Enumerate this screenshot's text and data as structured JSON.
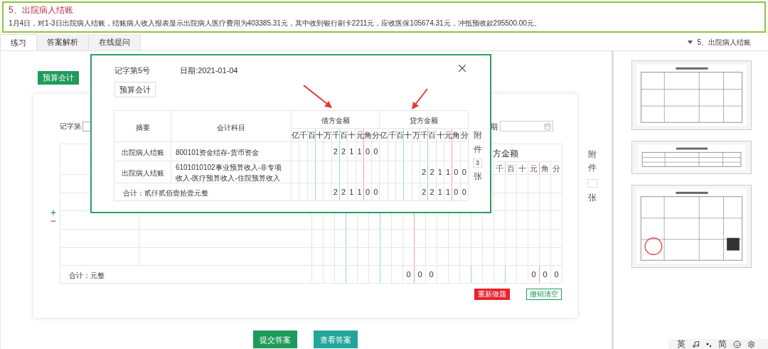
{
  "question": {
    "title": "5、出院病人结账",
    "description": "1月4日，对1-3日出院病人结账，结账病人收入报表显示出院病人医疗费用为403385.31元，其中收到银行刷卡2211元，应收医保105674.31元，冲抵预收款295500.00元。"
  },
  "tabs": [
    {
      "label": "练习",
      "selected": true
    },
    {
      "label": "答案解析",
      "selected": false
    },
    {
      "label": "在线提问",
      "selected": false
    }
  ],
  "question_selector": "5、出院病人结账",
  "ledger_button": "预算会计",
  "voucher_form": {
    "number_label": "记字第",
    "date_label": "期",
    "credit_header": "方金额",
    "credit_digit_labels": [
      "千",
      "百",
      "十",
      "元",
      "角",
      "分"
    ],
    "total_label": "合计：元整",
    "total_debit": [
      "0",
      "0",
      "0"
    ],
    "total_credit": [
      "0",
      "0",
      "0"
    ],
    "attachments_label": "附件",
    "attachments_unit": "张"
  },
  "form_buttons": [
    {
      "label": "重新做题",
      "kind": "danger"
    },
    {
      "label": "撤销清空",
      "kind": "outline"
    }
  ],
  "bottom_buttons": [
    {
      "label": "提交答案",
      "kind": "primary"
    },
    {
      "label": "查看答案",
      "kind": "secondary"
    }
  ],
  "dialog": {
    "voucher_no": "记字第5号",
    "date": "日期:2021-01-04",
    "ledger_tag": "预算会计",
    "columns": {
      "summary": "摘要",
      "account": "会计科目",
      "debit": "借方金额",
      "credit": "贷方金额"
    },
    "debit_digit_labels": [
      "亿",
      "千",
      "百",
      "十",
      "万",
      "千",
      "百",
      "十",
      "元",
      "角",
      "分"
    ],
    "credit_digit_labels": [
      "亿",
      "千",
      "百",
      "十",
      "万",
      "千",
      "百",
      "十",
      "元",
      "角",
      "分"
    ],
    "rows": [
      {
        "summary": "出院病人结账",
        "account": "800101资金结存-货币资金",
        "debit": [
          "2",
          "2",
          "1",
          "1",
          "0",
          "0"
        ]
      },
      {
        "summary": "出院病人结账",
        "account": "6101010102事业预算收入-非专项收入-医疗预算收入-住院预算收入",
        "credit": [
          "2",
          "2",
          "1",
          "1",
          "0",
          "0"
        ]
      }
    ],
    "total": {
      "label": "合计：贰仟贰佰壹拾壹元整",
      "debit": [
        "2",
        "2",
        "1",
        "1",
        "0",
        "0"
      ],
      "credit": [
        "2",
        "2",
        "1",
        "1",
        "0",
        "0"
      ]
    },
    "attachments": {
      "label": "附件",
      "count": "3",
      "unit": "张"
    }
  },
  "ime_bar": {
    "labels": [
      "英",
      "简"
    ]
  }
}
